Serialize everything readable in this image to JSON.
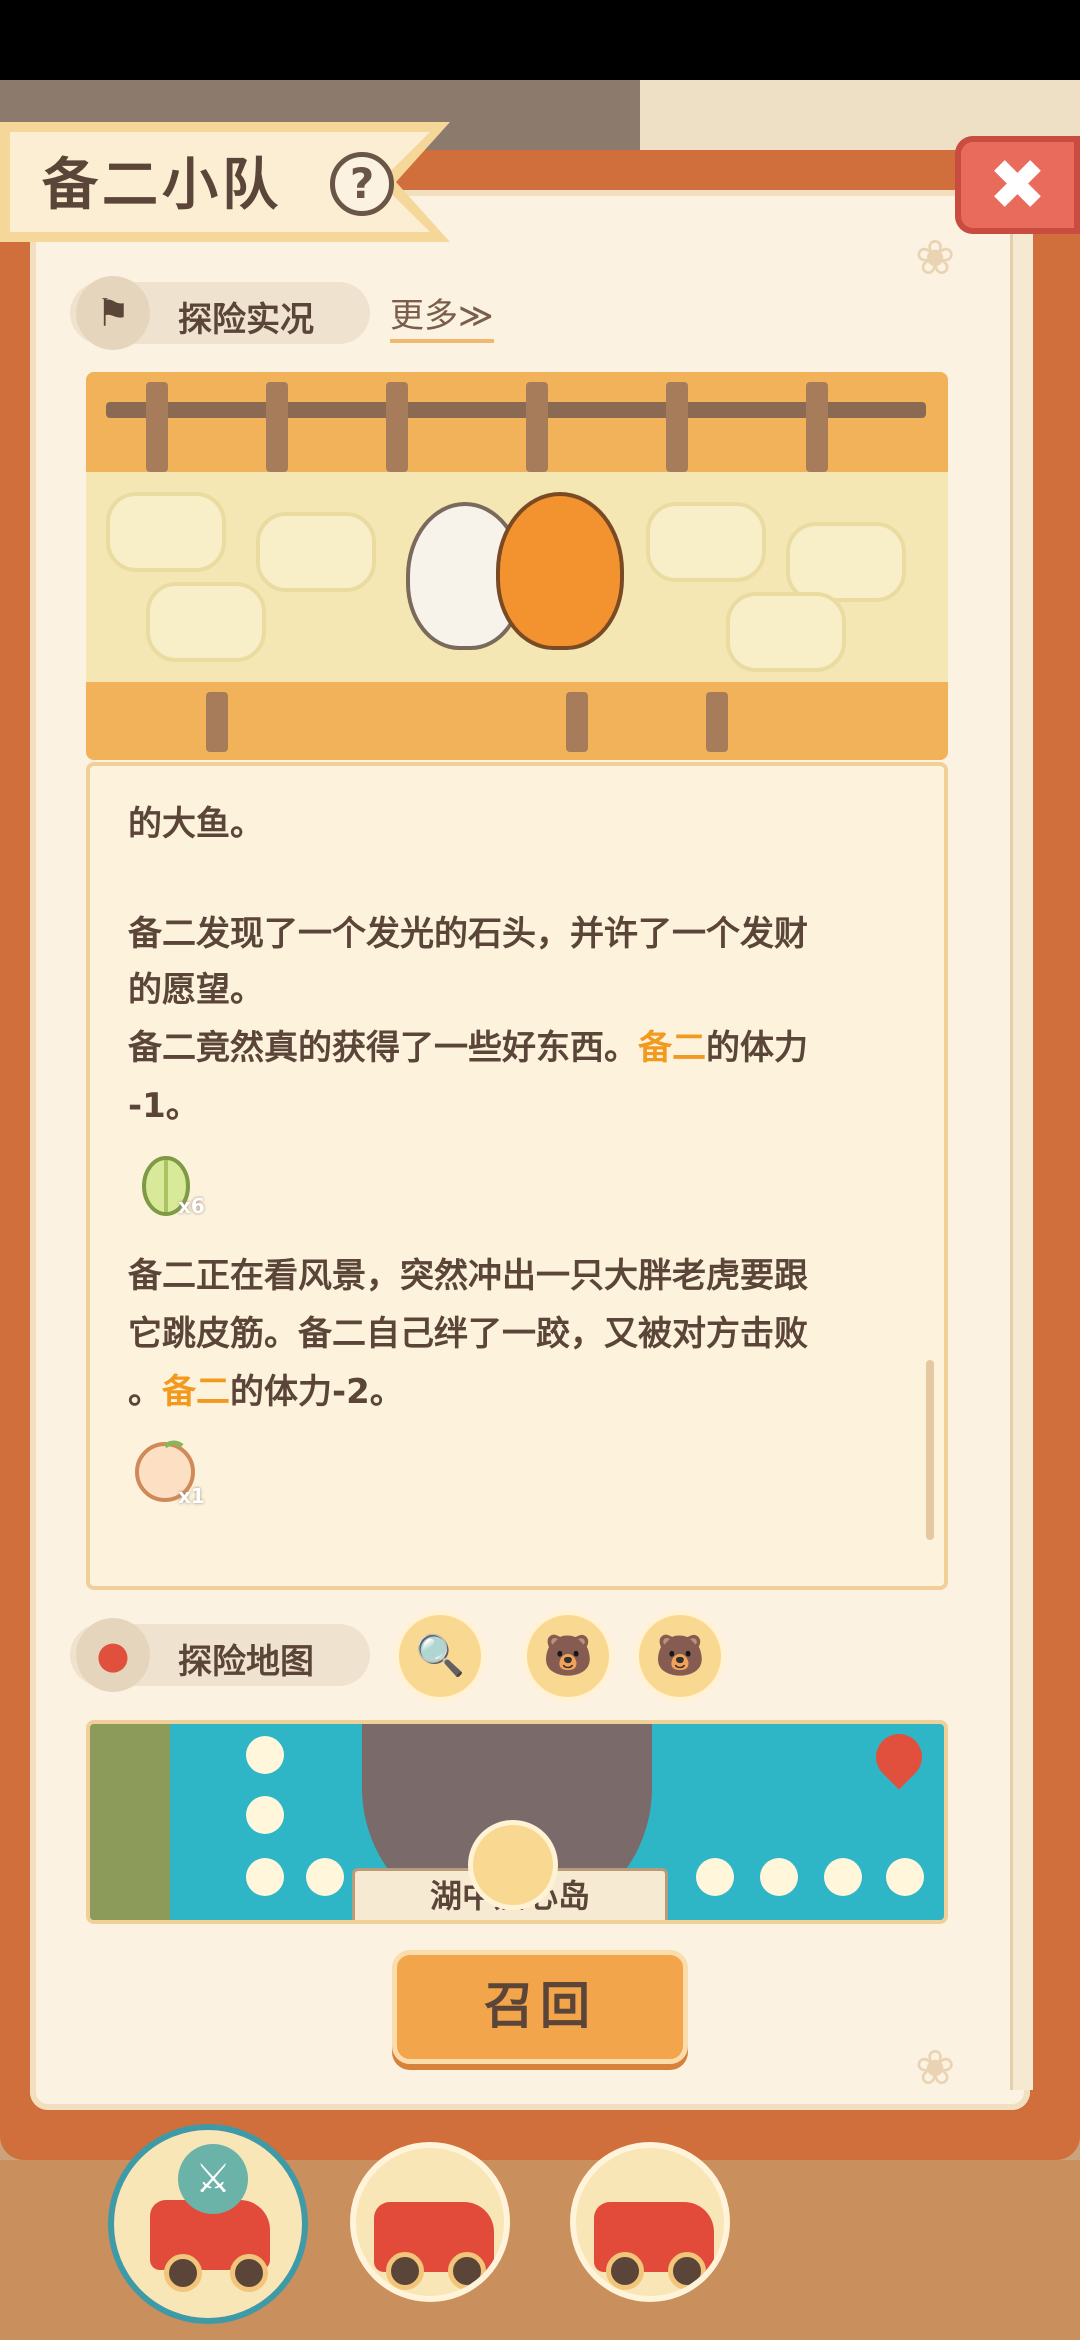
{
  "header": {
    "title": "备二小队",
    "help_glyph": "?",
    "close_glyph": "✖"
  },
  "report_section": {
    "label": "探险实况",
    "more_link": "更多≫",
    "icon": "flag-icon"
  },
  "log": {
    "lines": [
      {
        "parts": [
          {
            "text": "的大鱼。",
            "hl": false
          }
        ]
      },
      {
        "parts": [
          {
            "text": "备二发现了一个发光的石头，并许了一个发财",
            "hl": false
          }
        ]
      },
      {
        "parts": [
          {
            "text": "的愿望。",
            "hl": false
          }
        ]
      },
      {
        "parts": [
          {
            "text": "备二竟然真的获得了一些好东西。",
            "hl": false
          },
          {
            "text": "备二",
            "hl": true
          },
          {
            "text": "的体力",
            "hl": false
          }
        ]
      },
      {
        "parts": [
          {
            "text": "-1。",
            "hl": false
          }
        ]
      },
      {
        "parts": [
          {
            "text": "备二正在看风景，突然冲出一只大胖老虎要跟",
            "hl": false
          }
        ]
      },
      {
        "parts": [
          {
            "text": "它跳皮筋。备二自己绊了一跤，又被对方击败",
            "hl": false
          }
        ]
      },
      {
        "parts": [
          {
            "text": "。",
            "hl": false
          },
          {
            "text": "备二",
            "hl": true
          },
          {
            "text": "的体力-2。",
            "hl": false
          }
        ]
      }
    ],
    "rewards": [
      {
        "icon": "cabbage-icon",
        "count": "x6"
      },
      {
        "icon": "peach-icon",
        "count": "x1"
      }
    ],
    "highlight_color": "#f29a1f"
  },
  "map_section": {
    "label": "探险地图",
    "icon": "location-pin-icon",
    "buttons": [
      {
        "icon": "magnifier-icon"
      },
      {
        "icon": "bear-avatar-icon"
      },
      {
        "icon": "bear-avatar-icon"
      }
    ],
    "location_label": "湖中爱心岛"
  },
  "actions": {
    "recall_label": "召回"
  },
  "vehicles": [
    {
      "icon": "truck-icon",
      "active": true
    },
    {
      "icon": "truck-icon",
      "active": false
    },
    {
      "icon": "truck-icon",
      "active": false
    }
  ],
  "colors": {
    "book_cover": "#d06f3c",
    "page": "#fbf2e2",
    "accent": "#f3a54c",
    "text": "#5b4538"
  }
}
